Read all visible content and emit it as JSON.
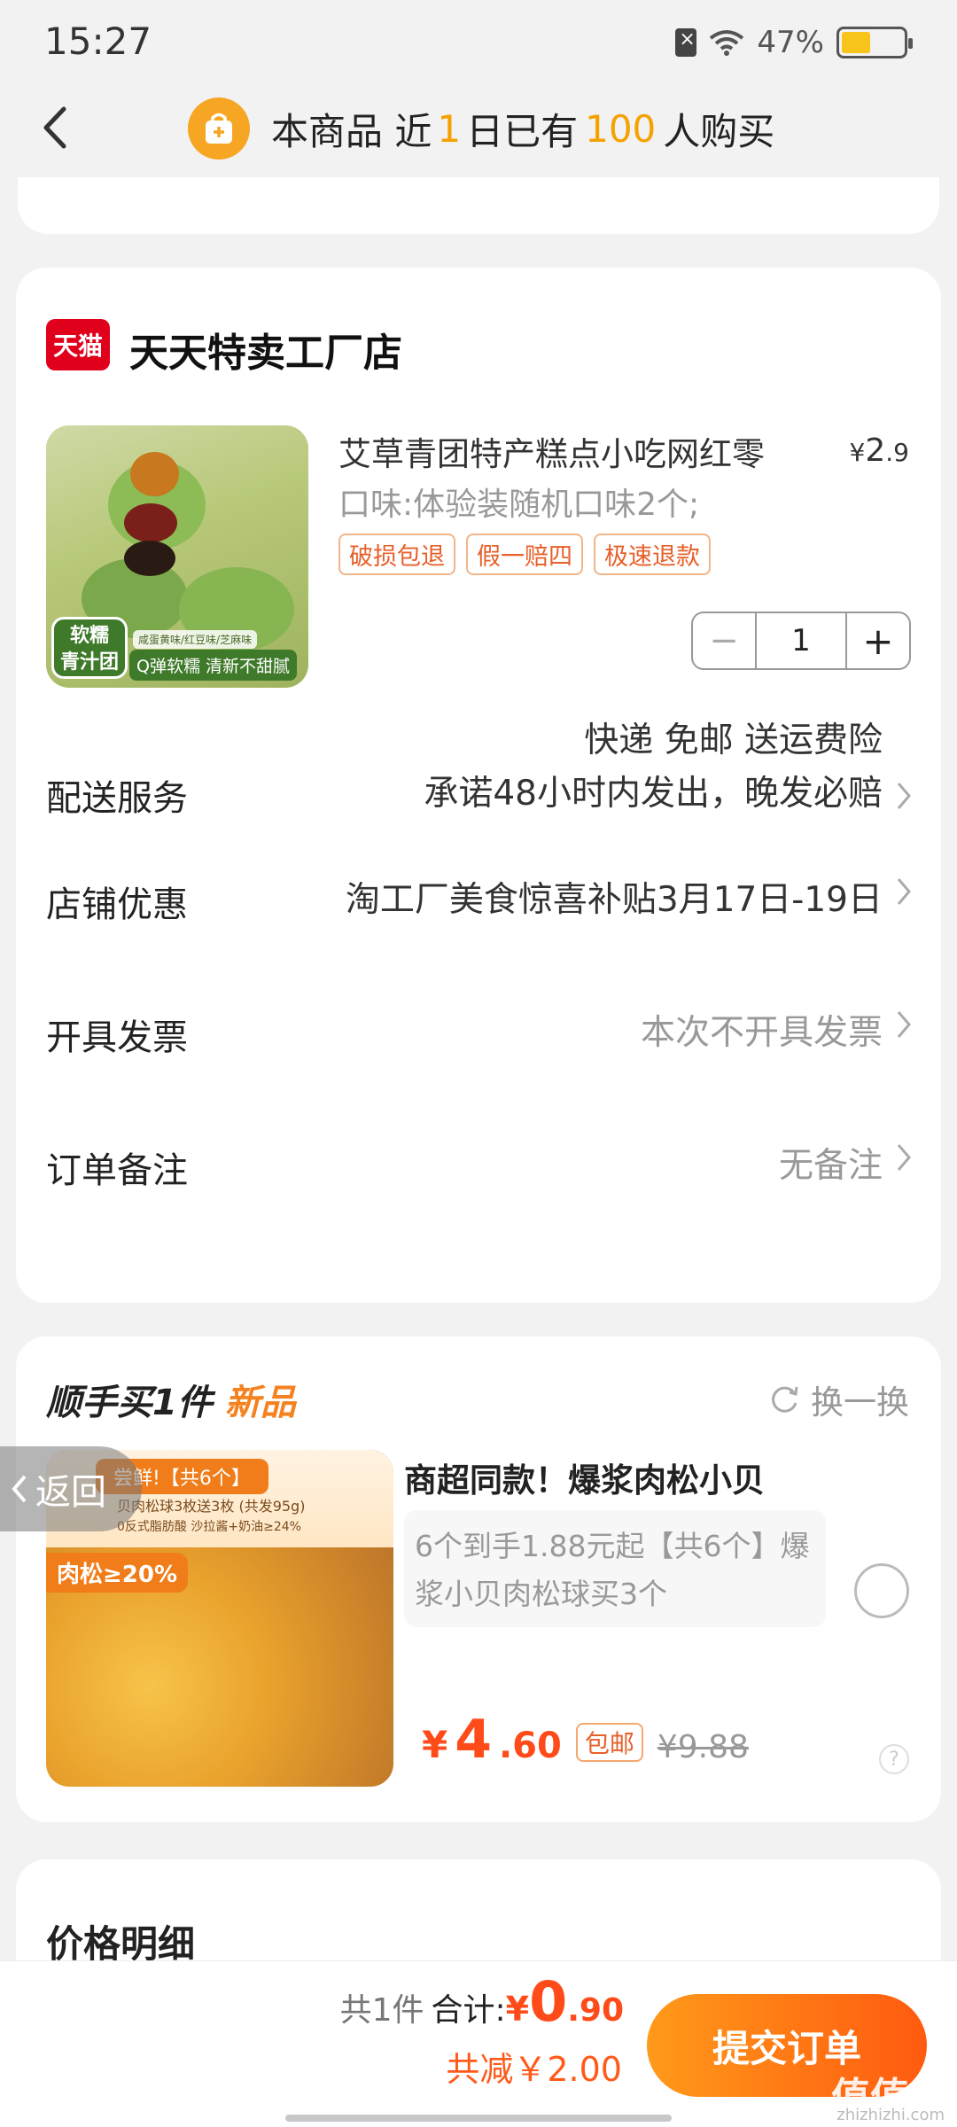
{
  "status": {
    "time": "15:27",
    "battery_percent": "47%",
    "battery_level": 0.47
  },
  "header": {
    "msg_prefix": "本商品 近",
    "days": "1",
    "msg_mid": "日已有",
    "count": "100",
    "msg_suffix": "人购买"
  },
  "store": {
    "logo_text": "天猫",
    "name": "天天特卖工厂店"
  },
  "product": {
    "title": "艾草青团特产糕点小吃网红零",
    "price_symbol": "¥",
    "price_int": "2",
    "price_dec": ".9",
    "spec": "口味:体验装随机口味2个;",
    "tags": [
      "破损包退",
      "假一赔四",
      "极速退款"
    ],
    "image_badge": "软糯\n青汁团",
    "image_slogan": "Q弹软糯 清新不甜腻",
    "image_flavors": "咸蛋黄味/红豆味/芝麻味",
    "quantity": "1",
    "minus": "−",
    "plus": "+"
  },
  "rows": {
    "delivery_label": "配送服务",
    "delivery_line1": "快递 免邮 送运费险",
    "delivery_line2": "承诺48小时内发出，晚发必赔",
    "discount_label": "店铺优惠",
    "discount_value": "淘工厂美食惊喜补贴3月17日-19日",
    "invoice_label": "开具发票",
    "invoice_value": "本次不开具发票",
    "note_label": "订单备注",
    "note_value": "无备注"
  },
  "recommend": {
    "title": "顺手买1件",
    "title_tag": "新品",
    "refresh_label": "换一换",
    "name": "商超同款！爆浆肉松小贝",
    "desc": "6个到手1.88元起【共6个】爆浆小贝肉松球买3个",
    "price_yen": "¥",
    "price_int": "4",
    "price_dec": ".60",
    "shipping": "包邮",
    "orig_price": "¥9.88",
    "img_fresh": "尝鲜!【共6个】",
    "img_sub": "贝肉松球3枚送3枚 (共发95g)",
    "img_sub2": "0反式脂肪酸   沙拉酱+奶油≥24%",
    "img_meatfloss": "肉松≥20%",
    "help": "?"
  },
  "float_back": {
    "label": "返回"
  },
  "details": {
    "title": "价格明细"
  },
  "bottom": {
    "count": "共1件",
    "total_label": "合计:",
    "yen": "¥",
    "total_int": "0",
    "total_dec": ".90",
    "saving": "共减￥2.00",
    "submit": "提交订单"
  },
  "watermark": {
    "main": "值值值",
    "sub": "zhizhizhi.com"
  }
}
